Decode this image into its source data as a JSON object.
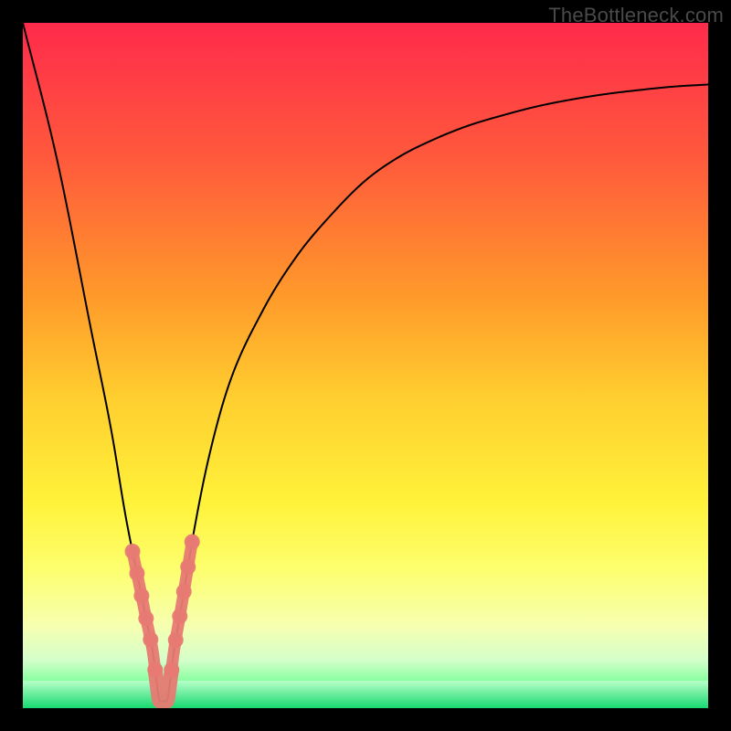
{
  "watermark": "TheBottleneck.com",
  "chart_data": {
    "type": "line",
    "title": "",
    "xlabel": "",
    "ylabel": "",
    "xlim": [
      0,
      100
    ],
    "ylim": [
      0,
      100
    ],
    "series": [
      {
        "name": "bottleneck-curve",
        "x": [
          0,
          5,
          10,
          13,
          15,
          17,
          18,
          19,
          19.5,
          20,
          21,
          21.5,
          22,
          23,
          24,
          25,
          27,
          30,
          35,
          40,
          45,
          50,
          55,
          60,
          65,
          70,
          75,
          80,
          85,
          90,
          95,
          100
        ],
        "values": [
          100,
          80,
          55,
          40,
          28,
          18,
          13,
          8,
          4,
          1,
          1,
          4,
          8,
          14,
          20,
          26,
          36,
          47,
          58,
          66,
          72,
          77,
          80.5,
          83,
          85,
          86.5,
          87.8,
          88.8,
          89.6,
          90.2,
          90.7,
          91
        ]
      }
    ],
    "highlight_segments": [
      {
        "series": "bottleneck-curve",
        "x_start": 16.0,
        "x_end": 19.3,
        "side": "left"
      },
      {
        "series": "bottleneck-curve",
        "x_start": 19.3,
        "x_end": 21.7,
        "side": "bottom"
      },
      {
        "series": "bottleneck-curve",
        "x_start": 21.7,
        "x_end": 24.7,
        "side": "right"
      }
    ],
    "highlight_color": "#e77a73",
    "gradient_stops": [
      {
        "pos": 0.0,
        "color": "#ff2a4b"
      },
      {
        "pos": 0.2,
        "color": "#ff5a3c"
      },
      {
        "pos": 0.4,
        "color": "#ff9a2a"
      },
      {
        "pos": 0.55,
        "color": "#ffcf2f"
      },
      {
        "pos": 0.7,
        "color": "#fff23a"
      },
      {
        "pos": 0.8,
        "color": "#fdff70"
      },
      {
        "pos": 0.88,
        "color": "#f6ffb0"
      },
      {
        "pos": 0.93,
        "color": "#d4ffca"
      },
      {
        "pos": 0.965,
        "color": "#7dff9a"
      },
      {
        "pos": 1.0,
        "color": "#17d96f"
      }
    ],
    "green_band": {
      "y_start": 0,
      "y_end": 4,
      "color_top": "#b8ffc8",
      "color_bottom": "#17d96f"
    }
  }
}
